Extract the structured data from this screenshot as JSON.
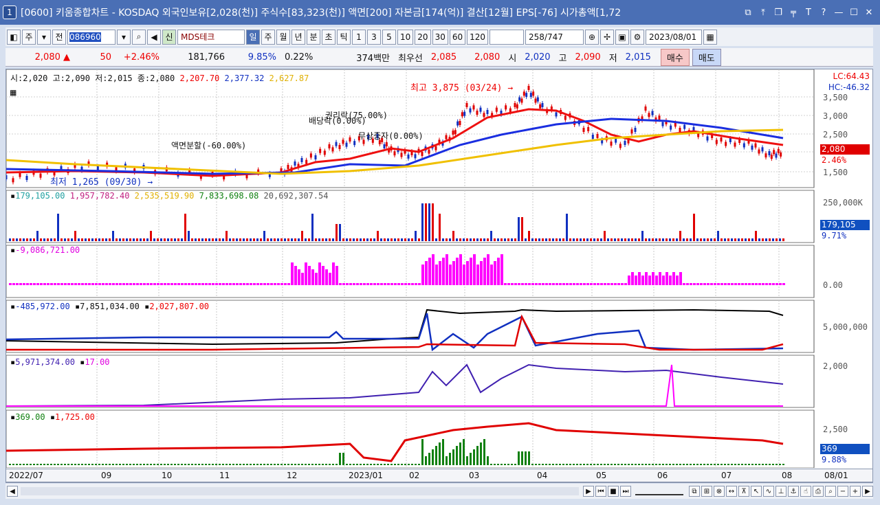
{
  "window": {
    "badge": "1",
    "title": "[0600] 키움종합차트 - KOSDAQ 외국인보유[2,028(천)] 주식수[83,323(천)] 액면[200] 자본금[174(억)] 결산[12월] EPS[-76] 시가총액[1,72"
  },
  "toolbar": {
    "type_label": "주",
    "prev_label": "전",
    "code": "086960",
    "market_tag": "신",
    "name": "MDS테크",
    "periods": [
      "일",
      "주",
      "월",
      "년",
      "분",
      "초",
      "틱"
    ],
    "nums": [
      "1",
      "3",
      "5",
      "10",
      "20",
      "30",
      "60",
      "120"
    ],
    "count": "258",
    "total": "/747",
    "date": "2023/08/01"
  },
  "quote": {
    "price": "2,080",
    "change": "50",
    "pct": "+2.46%",
    "volume": "181,766",
    "rate1": "9.85%",
    "rate2": "0.22%",
    "amount": "374백만",
    "best_label": "최우선",
    "ask": "2,085",
    "bid": "2,080",
    "open_label": "시",
    "open": "2,020",
    "high_label": "고",
    "high": "2,090",
    "low_label": "저",
    "low": "2,015",
    "buy_label": "매수",
    "sell_label": "매도"
  },
  "panels": {
    "price": {
      "legend": "시:2,020 고:2,090 저:2,015 종:2,080",
      "ma1": "2,207.70",
      "ma2": "2,377.32",
      "ma3": "2,627.87",
      "lc": "LC:64.43",
      "hc": "HC:-46.32",
      "last_tag": "2,080",
      "pct_tag": "2.46%",
      "y_ticks": [
        "3,500",
        "3,000",
        "2,500",
        "1,500"
      ],
      "high_note": "최고 3,875 (03/24)",
      "low_note": "최저 1,265 (09/30)",
      "split_note": "액면분할(-60.00%)",
      "div_note": "배당락(0.00%)",
      "right_note": "권리락(75.00%)",
      "free_note": "무상증자(0.00%)"
    },
    "volume": {
      "v1": "179,105.00",
      "v2": "1,957,782.40",
      "v3": "2,535,519.90",
      "v4": "7,833,698.08",
      "v5": "20,692,307.54",
      "y_tick": "250,000K",
      "tag": "179,105",
      "pct": "9.71%"
    },
    "p3": {
      "v1": "-9,086,721.00",
      "y_tick": "0.00"
    },
    "p4": {
      "v1": "-485,972.00",
      "v2": "7,851,034.00",
      "v3": "2,027,807.00",
      "y_tick": "5,000,000"
    },
    "p5": {
      "v1": "5,971,374.00",
      "v2": "17.00",
      "y_tick": "2,000"
    },
    "p6": {
      "v1": "369.00",
      "v2": "1,725.00",
      "y_tick": "2,500",
      "tag": "369",
      "pct": "9.88%"
    }
  },
  "xaxis": {
    "labels": [
      "2022/07",
      "09",
      "10",
      "11",
      "12",
      "2023/01",
      "02",
      "03",
      "04",
      "05",
      "06",
      "07",
      "08"
    ],
    "right": "08/01"
  },
  "colors": {
    "up": "#e00000",
    "down": "#1030c0",
    "ma_red": "#ee1010",
    "ma_blue": "#1a2ee0",
    "ma_yellow": "#f0c000",
    "magenta": "#ff00ff",
    "green": "#108010",
    "purple": "#4020b0"
  }
}
